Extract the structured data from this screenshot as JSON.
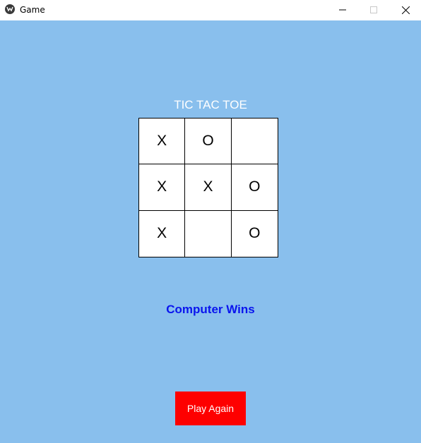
{
  "window": {
    "title": "Game",
    "icons": {
      "app": "app-icon",
      "minimize": "minimize-icon",
      "maximize": "maximize-icon",
      "close": "close-icon"
    }
  },
  "game": {
    "title": "TIC TAC TOE",
    "board": [
      [
        "X",
        "O",
        ""
      ],
      [
        "X",
        "X",
        "O"
      ],
      [
        "X",
        "",
        "O"
      ]
    ],
    "status": "Computer Wins",
    "play_again_label": "Play Again"
  },
  "colors": {
    "background": "#89bfed",
    "status_text": "#0a14ee",
    "play_again_button": "#fe0000",
    "title_text": "#ffffff"
  }
}
